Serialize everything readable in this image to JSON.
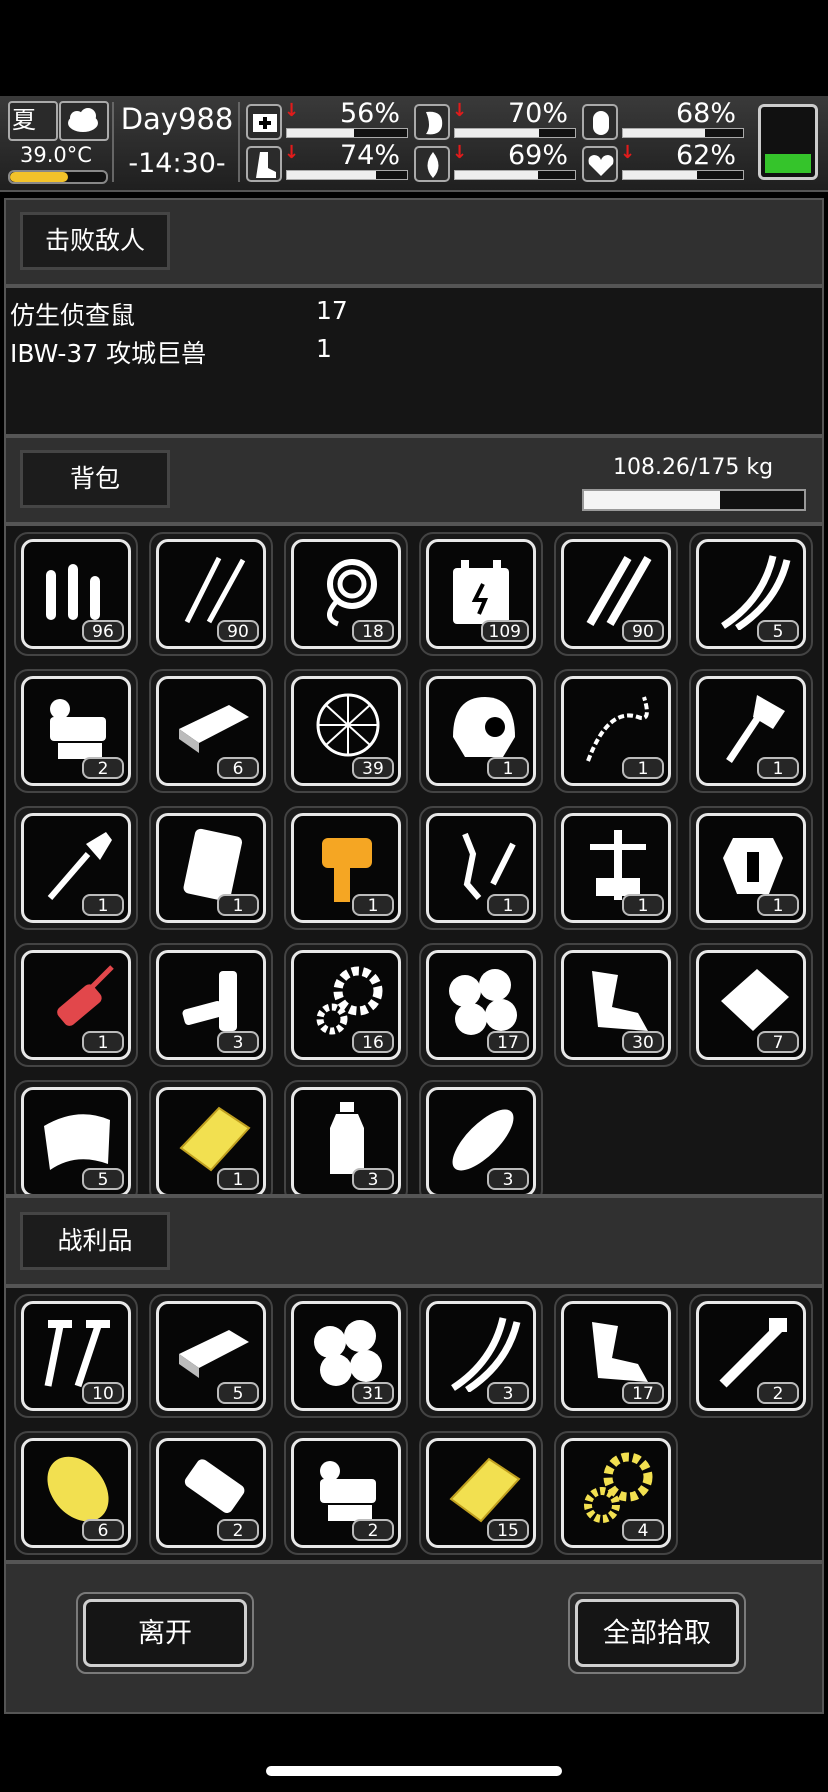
{
  "status": {
    "season": "夏",
    "temperature": "39.0°C",
    "temperature_level": 0.6,
    "day": "Day988",
    "time": "-14:30-",
    "stats": [
      {
        "icon": "medkit-icon",
        "value": "56%",
        "fill": 0.56,
        "down": true
      },
      {
        "icon": "stomach-icon",
        "value": "70%",
        "fill": 0.7,
        "down": true
      },
      {
        "icon": "bladder-icon",
        "value": "68%",
        "fill": 0.68,
        "down": false
      },
      {
        "icon": "boot-icon",
        "value": "74%",
        "fill": 0.74,
        "down": true
      },
      {
        "icon": "water-drop-icon",
        "value": "69%",
        "fill": 0.69,
        "down": true
      },
      {
        "icon": "heart-icon",
        "value": "62%",
        "fill": 0.62,
        "down": true
      }
    ],
    "energy_level": 0.3
  },
  "defeated": {
    "title": "击败敌人",
    "rows": [
      {
        "name": "仿生侦查鼠",
        "count": "17"
      },
      {
        "name": "IBW-37 攻城巨兽",
        "count": "1"
      }
    ]
  },
  "backpack": {
    "title": "背包",
    "weight": "108.26/175 kg",
    "weight_level": 0.619,
    "items": [
      {
        "icon": "bullets-icon",
        "count": "96",
        "color": "#ffffff"
      },
      {
        "icon": "lockpick-icon",
        "count": "90",
        "color": "#ffffff"
      },
      {
        "icon": "rope-icon",
        "count": "18",
        "color": "#ffffff"
      },
      {
        "icon": "battery-pack-icon",
        "count": "109",
        "color": "#ffffff"
      },
      {
        "icon": "rifle-rounds-icon",
        "count": "90",
        "color": "#ffffff"
      },
      {
        "icon": "wires-icon",
        "count": "5",
        "color": "#ffffff"
      },
      {
        "icon": "machine-part-icon",
        "count": "2",
        "color": "#ffffff"
      },
      {
        "icon": "metal-plate-icon",
        "count": "6",
        "color": "#ffffff"
      },
      {
        "icon": "net-trap-icon",
        "count": "39",
        "color": "#ffffff"
      },
      {
        "icon": "helmet-icon",
        "count": "1",
        "color": "#ffffff"
      },
      {
        "icon": "chain-whip-icon",
        "count": "1",
        "color": "#ffffff"
      },
      {
        "icon": "axe-icon",
        "count": "1",
        "color": "#ffffff"
      },
      {
        "icon": "shovel-icon",
        "count": "1",
        "color": "#ffffff"
      },
      {
        "icon": "case-icon",
        "count": "1",
        "color": "#ffffff"
      },
      {
        "icon": "chainsaw-icon",
        "count": "1",
        "color": "#f5a623"
      },
      {
        "icon": "robot-arm-icon",
        "count": "1",
        "color": "#ffffff"
      },
      {
        "icon": "frame-icon",
        "count": "1",
        "color": "#ffffff"
      },
      {
        "icon": "armor-icon",
        "count": "1",
        "color": "#ffffff"
      },
      {
        "icon": "guitar-gun-icon",
        "count": "1",
        "color": "#e2474b"
      },
      {
        "icon": "batteries-icon",
        "count": "3",
        "color": "#ffffff"
      },
      {
        "icon": "gears-icon",
        "count": "16",
        "color": "#ffffff"
      },
      {
        "icon": "cotton-icon",
        "count": "17",
        "color": "#ffffff"
      },
      {
        "icon": "scrap-metal-icon",
        "count": "30",
        "color": "#ffffff"
      },
      {
        "icon": "steel-sheet-icon",
        "count": "7",
        "color": "#ffffff"
      },
      {
        "icon": "cloth-icon",
        "count": "5",
        "color": "#ffffff"
      },
      {
        "icon": "gold-plate-icon",
        "count": "1",
        "color": "#f2e050"
      },
      {
        "icon": "water-bottle-icon",
        "count": "3",
        "color": "#ffffff"
      },
      {
        "icon": "bread-icon",
        "count": "3",
        "color": "#ffffff"
      }
    ]
  },
  "loot": {
    "title": "战利品",
    "items": [
      {
        "icon": "screws-icon",
        "count": "10",
        "color": "#ffffff"
      },
      {
        "icon": "metal-plate-icon",
        "count": "5",
        "color": "#ffffff"
      },
      {
        "icon": "cotton-icon",
        "count": "31",
        "color": "#ffffff"
      },
      {
        "icon": "wires-icon",
        "count": "3",
        "color": "#ffffff"
      },
      {
        "icon": "scrap-metal-icon",
        "count": "17",
        "color": "#ffffff"
      },
      {
        "icon": "pipe-icon",
        "count": "2",
        "color": "#ffffff"
      },
      {
        "icon": "yellow-cylinder-icon",
        "count": "6",
        "color": "#f2e050"
      },
      {
        "icon": "weapon-part-icon",
        "count": "2",
        "color": "#ffffff"
      },
      {
        "icon": "machine-part-icon",
        "count": "2",
        "color": "#ffffff"
      },
      {
        "icon": "gold-plate-icon",
        "count": "15",
        "color": "#f2e050"
      },
      {
        "icon": "gold-gears-icon",
        "count": "4",
        "color": "#f2e050"
      }
    ]
  },
  "actions": {
    "leave": "离开",
    "take_all": "全部拾取"
  }
}
